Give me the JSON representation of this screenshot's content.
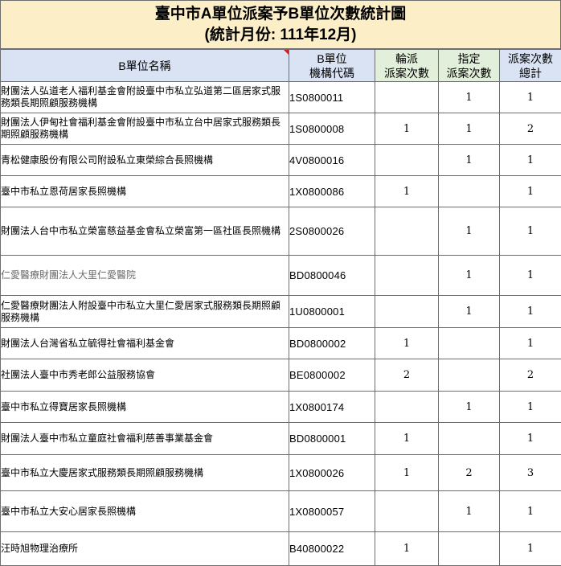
{
  "title": {
    "line1": "臺中市A單位派案予B單位次數統計圖",
    "line2": "(統計月份: 111年12月)"
  },
  "columns": {
    "name": "B單位名稱",
    "code_line1": "B單位",
    "code_line2": "機構代碼",
    "rotation_line1": "輪派",
    "rotation_line2": "派案次數",
    "assigned_line1": "指定",
    "assigned_line2": "派案次數",
    "total_line1": "派案次數",
    "total_line2": "總計"
  },
  "rows": [
    {
      "name": "財團法人弘道老人福利基金會附設臺中市私立弘道第二區居家式服務類長期照顧服務機構",
      "code": "1S0800011",
      "rotation": "",
      "assigned": "1",
      "total": "1"
    },
    {
      "name": "財團法人伊甸社會福利基金會附設臺中市私立台中居家式服務類長期照顧服務機構",
      "code": "1S0800008",
      "rotation": "1",
      "assigned": "1",
      "total": "2"
    },
    {
      "name": "青松健康股份有限公司附設私立東榮綜合長照機構",
      "code": "4V0800016",
      "rotation": "",
      "assigned": "1",
      "total": "1"
    },
    {
      "name": "臺中市私立恩荷居家長照機構",
      "code": "1X0800086",
      "rotation": "1",
      "assigned": "",
      "total": "1"
    },
    {
      "name": "財團法人台中市私立榮富慈益基金會私立榮富第一區社區長照機構",
      "code": "2S0800026",
      "rotation": "",
      "assigned": "1",
      "total": "1"
    },
    {
      "name": "仁愛醫療財團法人大里仁愛醫院",
      "code": "BD0800046",
      "rotation": "",
      "assigned": "1",
      "total": "1"
    },
    {
      "name": "仁愛醫療財團法人附設臺中市私立大里仁愛居家式服務類長期照顧服務機構",
      "code": "1U0800001",
      "rotation": "",
      "assigned": "1",
      "total": "1"
    },
    {
      "name": "財團法人台灣省私立毓得社會福利基金會",
      "code": "BD0800002",
      "rotation": "1",
      "assigned": "",
      "total": "1"
    },
    {
      "name": "社團法人臺中市秀老郎公益服務協會",
      "code": "BE0800002",
      "rotation": "2",
      "assigned": "",
      "total": "2"
    },
    {
      "name": "臺中市私立得寶居家長照機構",
      "code": "1X0800174",
      "rotation": "",
      "assigned": "1",
      "total": "1"
    },
    {
      "name": "財團法人臺中市私立童庭社會福利慈善事業基金會",
      "code": "BD0800001",
      "rotation": "1",
      "assigned": "",
      "total": "1"
    },
    {
      "name": "臺中市私立大慶居家式服務類長期照顧服務機構",
      "code": "1X0800026",
      "rotation": "1",
      "assigned": "2",
      "total": "3"
    },
    {
      "name": "臺中市私立大安心居家長照機構",
      "code": "1X0800057",
      "rotation": "",
      "assigned": "1",
      "total": "1"
    },
    {
      "name": "汪時旭物理治療所",
      "code": "B40800022",
      "rotation": "1",
      "assigned": "",
      "total": "1"
    }
  ]
}
